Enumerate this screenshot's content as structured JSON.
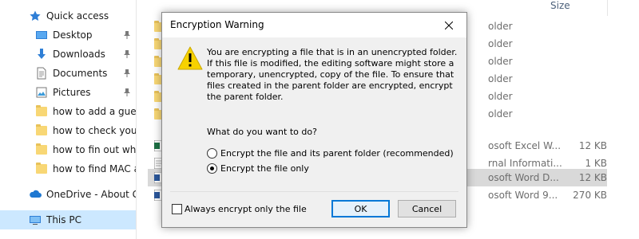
{
  "nav": {
    "quick_access": "Quick access",
    "items": [
      {
        "label": "Desktop",
        "icon": "desktop-icon",
        "pinned": true
      },
      {
        "label": "Downloads",
        "icon": "downloads-icon",
        "pinned": true
      },
      {
        "label": "Documents",
        "icon": "documents-icon",
        "pinned": true
      },
      {
        "label": "Pictures",
        "icon": "pictures-icon",
        "pinned": true
      },
      {
        "label": "how to add a guest",
        "icon": "folder-icon",
        "pinned": false
      },
      {
        "label": "how to check your r",
        "icon": "folder-icon",
        "pinned": false
      },
      {
        "label": "how to fin out what",
        "icon": "folder-icon",
        "pinned": false
      },
      {
        "label": "how to find MAC ac",
        "icon": "folder-icon",
        "pinned": false
      }
    ],
    "onedrive": "OneDrive - About Giv",
    "this_pc": "This PC"
  },
  "files": {
    "size_header": "Size",
    "rows": [
      {
        "type": "folder",
        "partial_type": "older",
        "size": ""
      },
      {
        "type": "folder",
        "partial_type": "older",
        "size": ""
      },
      {
        "type": "folder",
        "partial_type": "older",
        "size": ""
      },
      {
        "type": "folder",
        "partial_type": "older",
        "size": ""
      },
      {
        "type": "folder",
        "partial_type": "older",
        "size": ""
      },
      {
        "type": "folder",
        "partial_type": "older",
        "size": ""
      },
      {
        "type": "excel",
        "partial_type": "osoft Excel W...",
        "size": "12 KB"
      },
      {
        "type": "text",
        "partial_type": "rnal Informati...",
        "size": "1 KB"
      },
      {
        "type": "word",
        "partial_type": "osoft Word D...",
        "size": "12 KB"
      },
      {
        "type": "word",
        "partial_type": "osoft Word 9...",
        "size": "270 KB"
      }
    ]
  },
  "dialog": {
    "title": "Encryption Warning",
    "message": "You are encrypting a file that is in an unencrypted folder. If this file is modified, the editing software might store a temporary, unencrypted, copy of the file. To ensure that files created in the parent folder are encrypted, encrypt the parent folder.",
    "question": "What do you want to do?",
    "options": [
      {
        "label": "Encrypt the file and its parent folder (recommended)",
        "selected": false
      },
      {
        "label": "Encrypt the file only",
        "selected": true
      }
    ],
    "always_label": "Always encrypt only the file",
    "always_checked": false,
    "ok_label": "OK",
    "cancel_label": "Cancel"
  },
  "colors": {
    "accent": "#0078d7",
    "warning_yellow": "#f7d200",
    "selected_nav": "#cce8ff",
    "folder": "#f8d775"
  }
}
